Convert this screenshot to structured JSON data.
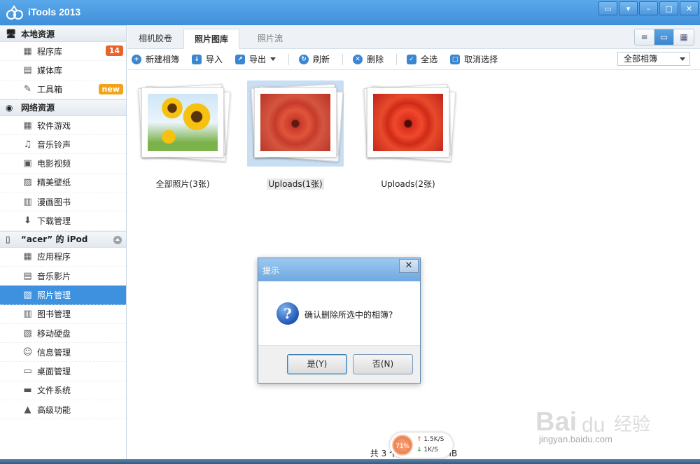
{
  "app": {
    "title": "iTools 2013"
  },
  "window_buttons": [
    "chat-icon",
    "menu-icon",
    "minimize-icon",
    "maximize-icon",
    "close-icon"
  ],
  "sidebar": {
    "sections": [
      {
        "title": "本地资源",
        "icon": "monitor-icon",
        "items": [
          {
            "label": "程序库",
            "icon": "grid-icon",
            "badge": "14"
          },
          {
            "label": "媒体库",
            "icon": "film-icon"
          },
          {
            "label": "工具箱",
            "icon": "wrench-icon",
            "badge": "new"
          }
        ]
      },
      {
        "title": "网络资源",
        "icon": "globe-icon",
        "items": [
          {
            "label": "软件游戏",
            "icon": "grid-icon"
          },
          {
            "label": "音乐铃声",
            "icon": "music-icon"
          },
          {
            "label": "电影视频",
            "icon": "video-icon"
          },
          {
            "label": "精美壁纸",
            "icon": "picture-icon"
          },
          {
            "label": "漫画图书",
            "icon": "book-icon"
          },
          {
            "label": "下载管理",
            "icon": "download-icon"
          }
        ]
      },
      {
        "title": "“acer” 的 iPod",
        "icon": "ipod-icon",
        "items": [
          {
            "label": "应用程序",
            "icon": "grid-icon"
          },
          {
            "label": "音乐影片",
            "icon": "film-icon"
          },
          {
            "label": "照片管理",
            "icon": "photo-icon",
            "active": true
          },
          {
            "label": "图书管理",
            "icon": "book-icon"
          },
          {
            "label": "移动硬盘",
            "icon": "zip-icon"
          },
          {
            "label": "信息管理",
            "icon": "contact-icon"
          },
          {
            "label": "桌面管理",
            "icon": "desktop-icon"
          },
          {
            "label": "文件系统",
            "icon": "folder-icon"
          },
          {
            "label": "高级功能",
            "icon": "flask-icon"
          }
        ]
      }
    ]
  },
  "tabs": [
    "相机胶卷",
    "照片图库",
    "照片流"
  ],
  "active_tab": "照片图库",
  "toolbar": {
    "new_album": "新建相簿",
    "import": "导入",
    "export": "导出",
    "refresh": "刷新",
    "delete": "删除",
    "select_all": "全选",
    "deselect": "取消选择",
    "album_filter": "全部相簿"
  },
  "albums": [
    {
      "label": "全部照片(3张)",
      "thumb": "sunflower"
    },
    {
      "label": "Uploads(1张)",
      "thumb": "dahlia",
      "selected": true
    },
    {
      "label": "Uploads(2张)",
      "thumb": "dahlia"
    }
  ],
  "dialog": {
    "title": "提示",
    "message": "确认删除所选中的相簿?",
    "yes": "是(Y)",
    "no": "否(N)"
  },
  "status": {
    "text": "共 3 个相簿，1.13 MB"
  },
  "speed_widget": {
    "percent": "71%",
    "up": "1.5K/S",
    "down": "1K/S"
  },
  "watermark": {
    "text": "jingyan.baidu.com"
  },
  "colors": {
    "accent": "#3e91df",
    "badge_red": "#e8642c",
    "badge_new": "#f3a31a"
  }
}
